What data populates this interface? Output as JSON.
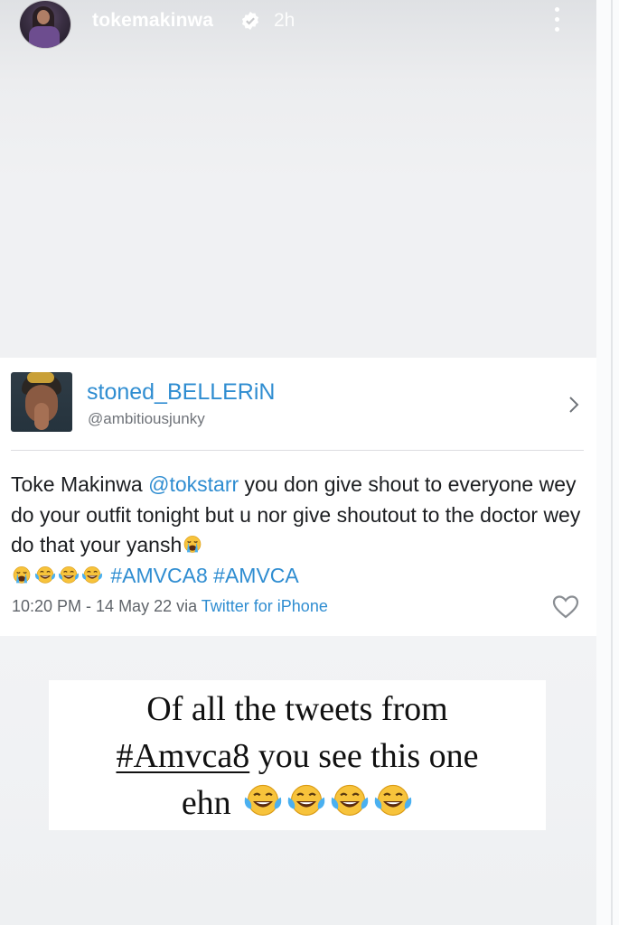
{
  "story": {
    "username": "tokemakinwa",
    "time": "2h",
    "verified": true,
    "icons": {
      "avatar": "profile-photo",
      "verified": "verified-badge-icon",
      "more": "more-vertical-icon"
    }
  },
  "tweet": {
    "display_name": "stoned_BELLERiN",
    "handle": "@ambitiousjunky",
    "text_parts": {
      "p1": "Toke Makinwa ",
      "mention": "@tokstarr",
      "p2": " you don give shout to everyone wey do your outfit tonight but u nor give shoutout to the doctor wey do that your yansh",
      "p3": " ",
      "tags": "#AMVCA8 #AMVCA"
    },
    "emojis": [
      "crying-face",
      "crying-face",
      "laughing-tears",
      "laughing-tears",
      "laughing-tears"
    ],
    "timestamp": "10:20 PM - 14 May 22 via ",
    "source": "Twitter for iPhone",
    "icons": {
      "chevron": "chevron-right-icon",
      "like": "heart-icon"
    }
  },
  "caption": {
    "line1": "Of all the tweets from",
    "hashtag": "#Amvca8",
    "line2": " you see this one",
    "line3": "ehn",
    "emojis": [
      "laughing-tears",
      "laughing-tears",
      "laughing-tears",
      "laughing-tears"
    ]
  },
  "colors": {
    "link": "#2f8dd1",
    "text": "#1c1e21",
    "meta": "#5f646a",
    "story_bg": "#f0f1f3"
  }
}
